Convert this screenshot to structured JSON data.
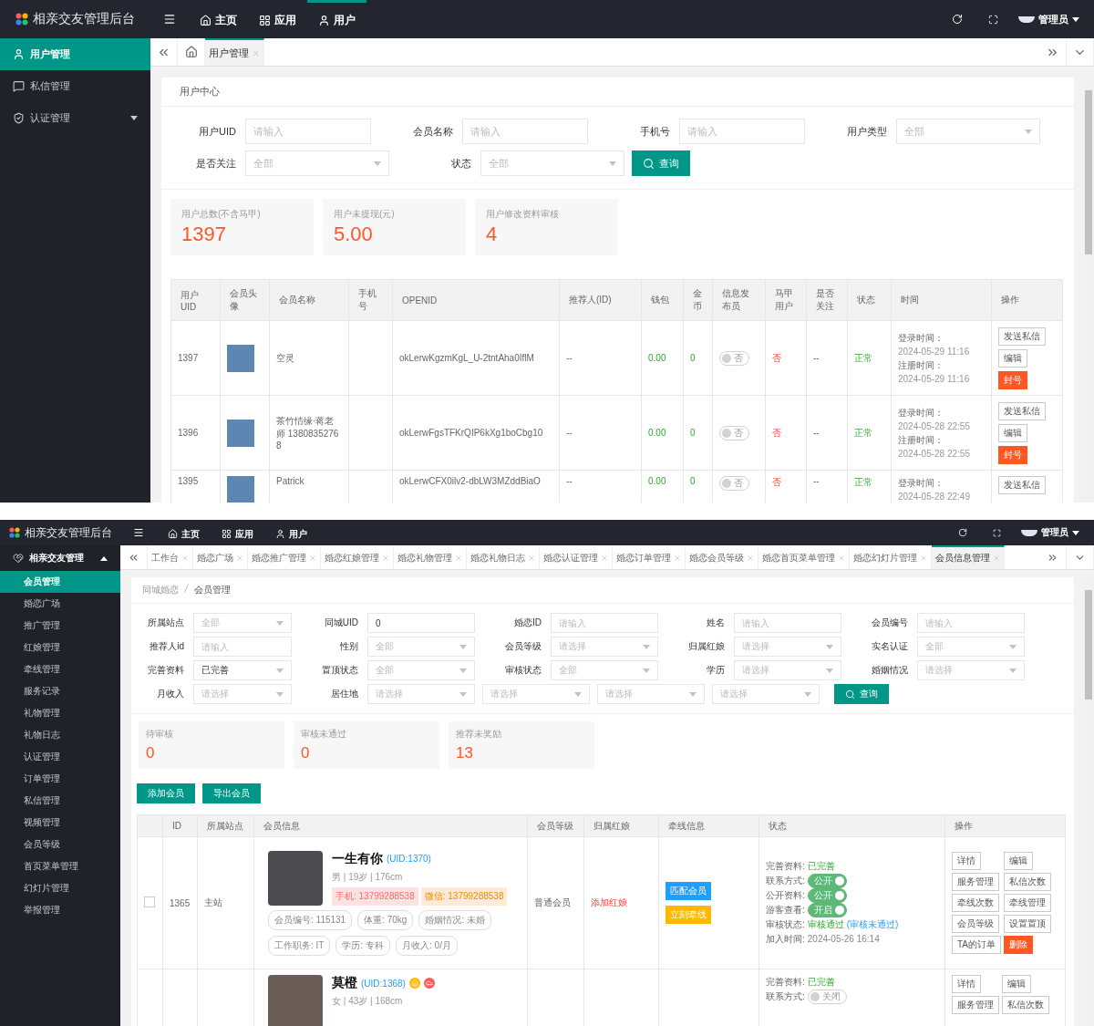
{
  "user_center": {
    "app_title": "相亲交友管理后台",
    "nav": [
      {
        "label": "主页",
        "selected": false
      },
      {
        "label": "应用",
        "selected": false
      },
      {
        "label": "用户",
        "selected": true
      }
    ],
    "admin": "管理员",
    "sidebar": [
      {
        "label": "用户管理",
        "selected": true,
        "has_children": false
      },
      {
        "label": "私信管理",
        "selected": false,
        "has_children": false
      },
      {
        "label": "认证管理",
        "selected": false,
        "has_children": true
      }
    ],
    "tabs": [
      {
        "label": "用户管理",
        "selected": true
      }
    ],
    "panel_title": "用户中心",
    "filter_rows": [
      [
        {
          "label": "用户UID",
          "kind": "input",
          "placeholder": "请输入"
        },
        {
          "label": "会员名称",
          "kind": "input",
          "placeholder": "请输入"
        },
        {
          "label": "手机号",
          "kind": "input",
          "placeholder": "请输入"
        },
        {
          "label": "用户类型",
          "kind": "select",
          "placeholder": "全部"
        }
      ],
      [
        {
          "label": "是否关注",
          "kind": "select",
          "placeholder": "全部"
        },
        {
          "label": "状态",
          "kind": "select",
          "placeholder": "全部"
        }
      ]
    ],
    "search_button": "查询",
    "stats": [
      {
        "label": "用户总数(不含马甲)",
        "value": "1397"
      },
      {
        "label": "用户未提现(元)",
        "value": "5.00"
      },
      {
        "label": "用户修改资料审核",
        "value": "4"
      }
    ],
    "table": {
      "columns": [
        "用户UID",
        "会员头像",
        "会员名称",
        "手机号",
        "OPENID",
        "推荐人(ID)",
        "钱包",
        "金币",
        "信息发布员",
        "马甲用户",
        "是否关注",
        "状态",
        "时间",
        "操作"
      ],
      "rows": [
        {
          "uid": "1397",
          "name": "空灵",
          "phone": "",
          "openid": "okLerwKgzmKgL_U-2tntAha0IflM",
          "referrer": "--",
          "wallet": "0.00",
          "gold": "0",
          "publisher": {
            "on": false,
            "text": "否"
          },
          "vest": "否",
          "follow": "--",
          "status": "正常",
          "times": [
            {
              "label": "登录时间：",
              "value": "2024-05-29 11:16"
            },
            {
              "label": "注册时间：",
              "value": "2024-05-29 11:16"
            }
          ],
          "actions": [
            {
              "label": "发送私信",
              "kind": "default"
            },
            {
              "label": "编辑",
              "kind": "default"
            },
            {
              "label": "封号",
              "kind": "danger"
            }
          ]
        },
        {
          "uid": "1396",
          "name": "茶竹情缘·蒋老师 13808352768",
          "phone": "",
          "openid": "okLerwFgsTFKrQIP6kXg1boCbg10",
          "referrer": "--",
          "wallet": "0.00",
          "gold": "0",
          "publisher": {
            "on": false,
            "text": "否"
          },
          "vest": "否",
          "follow": "--",
          "status": "正常",
          "times": [
            {
              "label": "登录时间：",
              "value": "2024-05-28 22:55"
            },
            {
              "label": "注册时间：",
              "value": "2024-05-28 22:55"
            }
          ],
          "actions": [
            {
              "label": "发送私信",
              "kind": "default"
            },
            {
              "label": "编辑",
              "kind": "default"
            },
            {
              "label": "封号",
              "kind": "danger"
            }
          ]
        },
        {
          "uid": "1395",
          "name": "Patrick",
          "phone": "",
          "openid": "okLerwCFX0ilv2-dbLW3MZddBiaO",
          "referrer": "--",
          "wallet": "0.00",
          "gold": "0",
          "publisher": {
            "on": false,
            "text": "否"
          },
          "vest": "否",
          "follow": "--",
          "status": "正常",
          "times": [
            {
              "label": "登录时间：",
              "value": "2024-05-28 22:49"
            }
          ],
          "actions": [
            {
              "label": "发送私信",
              "kind": "default"
            }
          ]
        }
      ]
    }
  },
  "member_admin": {
    "app_title": "相亲交友管理后台",
    "nav": [
      {
        "label": "主页",
        "selected": false
      },
      {
        "label": "应用",
        "selected": false
      },
      {
        "label": "用户",
        "selected": false
      }
    ],
    "admin": "管理员",
    "sidebar_group": {
      "label": "相亲交友管理",
      "expanded": true,
      "items": [
        {
          "label": "会员管理",
          "selected": true
        },
        {
          "label": "婚恋广场",
          "selected": false
        },
        {
          "label": "推广管理",
          "selected": false
        },
        {
          "label": "红娘管理",
          "selected": false
        },
        {
          "label": "牵线管理",
          "selected": false
        },
        {
          "label": "服务记录",
          "selected": false
        },
        {
          "label": "礼物管理",
          "selected": false
        },
        {
          "label": "礼物日志",
          "selected": false
        },
        {
          "label": "认证管理",
          "selected": false
        },
        {
          "label": "订单管理",
          "selected": false
        },
        {
          "label": "私信管理",
          "selected": false
        },
        {
          "label": "视频管理",
          "selected": false
        },
        {
          "label": "会员等级",
          "selected": false
        },
        {
          "label": "首页菜单管理",
          "selected": false
        },
        {
          "label": "幻灯片管理",
          "selected": false
        },
        {
          "label": "举报管理",
          "selected": false
        }
      ]
    },
    "tabs": [
      {
        "label": "工作台",
        "selected": false
      },
      {
        "label": "婚恋广场",
        "selected": false
      },
      {
        "label": "婚恋推广管理",
        "selected": false
      },
      {
        "label": "婚恋红娘管理",
        "selected": false
      },
      {
        "label": "婚恋礼物管理",
        "selected": false
      },
      {
        "label": "婚恋礼物日志",
        "selected": false
      },
      {
        "label": "婚恋认证管理",
        "selected": false
      },
      {
        "label": "婚恋订单管理",
        "selected": false
      },
      {
        "label": "婚恋会员等级",
        "selected": false
      },
      {
        "label": "婚恋首页菜单管理",
        "selected": false
      },
      {
        "label": "婚恋幻灯片管理",
        "selected": false
      },
      {
        "label": "会员信息管理",
        "selected": true
      }
    ],
    "breadcrumb": [
      "同城婚恋",
      "会员管理"
    ],
    "filter_rows": [
      [
        {
          "label": "所属站点",
          "kind": "select",
          "placeholder": "全部"
        },
        {
          "label": "同城UID",
          "kind": "input",
          "value": "0"
        },
        {
          "label": "婚恋ID",
          "kind": "input",
          "placeholder": "请输入"
        },
        {
          "label": "姓名",
          "kind": "input",
          "placeholder": "请输入"
        },
        {
          "label": "会员编号",
          "kind": "input",
          "placeholder": "请输入"
        }
      ],
      [
        {
          "label": "推荐人id",
          "kind": "input",
          "placeholder": "请输入"
        },
        {
          "label": "性别",
          "kind": "select",
          "placeholder": "全部"
        },
        {
          "label": "会员等级",
          "kind": "select",
          "placeholder": "请选择"
        },
        {
          "label": "归属红娘",
          "kind": "select",
          "placeholder": "请选择"
        },
        {
          "label": "实名认证",
          "kind": "select",
          "placeholder": "全部"
        }
      ],
      [
        {
          "label": "完善资料",
          "kind": "select",
          "value": "已完善"
        },
        {
          "label": "置顶状态",
          "kind": "select",
          "placeholder": "全部"
        },
        {
          "label": "审核状态",
          "kind": "select",
          "placeholder": "全部"
        },
        {
          "label": "学历",
          "kind": "select",
          "placeholder": "请选择"
        },
        {
          "label": "婚姻情况",
          "kind": "select",
          "placeholder": "请选择"
        }
      ],
      [
        {
          "label": "月收入",
          "kind": "select",
          "placeholder": "请选择"
        },
        {
          "label": "居住地",
          "kind": "multi",
          "placeholders": [
            "请选择",
            "请选择",
            "请选择",
            "请选择"
          ]
        }
      ]
    ],
    "search_button": "查询",
    "stats": [
      {
        "label": "待审核",
        "value": "0"
      },
      {
        "label": "审核未通过",
        "value": "0"
      },
      {
        "label": "推荐未奖励",
        "value": "13"
      }
    ],
    "actions": [
      "添加会员",
      "导出会员"
    ],
    "table": {
      "columns": [
        "",
        "ID",
        "所属站点",
        "会员信息",
        "会员等级",
        "归属红娘",
        "牵线信息",
        "状态",
        "操作"
      ],
      "rows": [
        {
          "checked": false,
          "id": "1365",
          "site": "主站",
          "name": "一生有你",
          "uid": "(UID:1370)",
          "basics": "男 | 19岁 | 176cm",
          "contacts": [
            {
              "kind": "phone",
              "text": "手机: 13799288538"
            },
            {
              "kind": "wechat",
              "text": "微信: 13799288538"
            }
          ],
          "tags": [
            "会员编号: 115131",
            "体重: 70kg",
            "婚姻情况: 未婚",
            "工作职务: IT",
            "学历: 专科",
            "月收入: 0/月"
          ],
          "level": "普通会员",
          "matchmaker": "添加红娘",
          "match_buttons": [
            {
              "kind": "match",
              "label": "匹配会员"
            },
            {
              "kind": "link",
              "label": "立刻牵线"
            }
          ],
          "status": [
            {
              "kind": "text",
              "label": "完善资料:",
              "value": "已完善"
            },
            {
              "kind": "switch",
              "label": "联系方式:",
              "on": true,
              "text": "公开"
            },
            {
              "kind": "switch",
              "label": "公开资料:",
              "on": true,
              "text": "公开"
            },
            {
              "kind": "switch",
              "label": "游客查看:",
              "on": true,
              "text": "开启"
            },
            {
              "kind": "review",
              "label": "审核状态:",
              "value": "审核通过",
              "link": "(审核未通过)"
            },
            {
              "kind": "time",
              "label": "加入时间:",
              "value": "2024-05-26 16:14"
            }
          ],
          "ops": [
            {
              "label": "详情",
              "kind": "default"
            },
            {
              "label": "编辑",
              "kind": "default"
            },
            {
              "label": "服务管理",
              "kind": "default"
            },
            {
              "label": "私信次数",
              "kind": "default"
            },
            {
              "label": "牵线次数",
              "kind": "default"
            },
            {
              "label": "牵线管理",
              "kind": "default"
            },
            {
              "label": "会员等级",
              "kind": "default"
            },
            {
              "label": "设置置顶",
              "kind": "default"
            },
            {
              "label": "TA的订单",
              "kind": "default"
            },
            {
              "label": "删除",
              "kind": "danger"
            }
          ]
        },
        {
          "name": "莫橙",
          "uid": "(UID:1368)",
          "house": true,
          "car": true,
          "basics": "女 | 43岁 | 168cm",
          "contacts": [],
          "tags": [],
          "match_buttons": [],
          "status": [
            {
              "kind": "text",
              "label": "完善资料:",
              "value": "已完善"
            },
            {
              "kind": "switch",
              "label": "联系方式:",
              "on": false,
              "text": "关闭"
            }
          ],
          "ops": [
            {
              "label": "详情",
              "kind": "default"
            },
            {
              "label": "编辑",
              "kind": "default"
            },
            {
              "label": "服务管理",
              "kind": "default"
            },
            {
              "label": "私信次数",
              "kind": "default"
            }
          ]
        }
      ]
    }
  }
}
